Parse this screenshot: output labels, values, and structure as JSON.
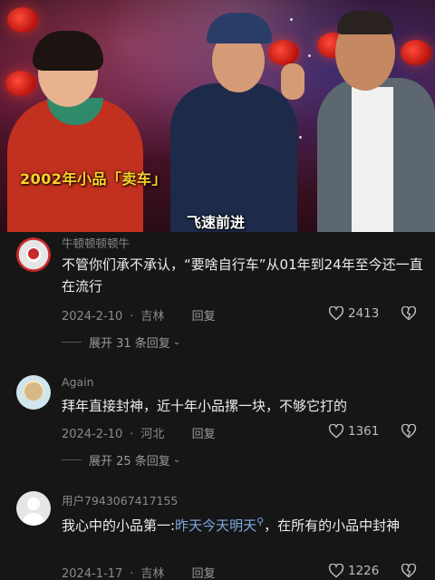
{
  "video": {
    "caption_title": "2002年小品「卖车」",
    "caption_action": "飞速前进"
  },
  "comments": [
    {
      "username": "牛顿顿顿顿牛",
      "text": "不管你们承不承认，“要啥自行车”从01年到24年至今还一直在流行",
      "date": "2024-2-10",
      "location": "吉林",
      "reply_label": "回复",
      "likes": "2413",
      "expand_label": "展开 31 条回复"
    },
    {
      "username": "Again",
      "text": "拜年直接封神，近十年小品摞一块，不够它打的",
      "date": "2024-2-10",
      "location": "河北",
      "reply_label": "回复",
      "likes": "1361",
      "expand_label": "展开 25 条回复"
    },
    {
      "username": "用户7943067417155",
      "text_before": "我心中的小品第一:",
      "text_link": "昨天今天明天",
      "text_after": "，在所有的小品中封神",
      "date": "2024-1-17",
      "location": "吉林",
      "reply_label": "回复",
      "likes": "1226"
    }
  ],
  "colors": {
    "accent_link": "#7fa8e0",
    "caption_yellow": "#ffd12a",
    "background": "#161616"
  },
  "icons": [
    "heart-icon",
    "dislike-icon",
    "chevron-down-icon",
    "search-icon"
  ]
}
